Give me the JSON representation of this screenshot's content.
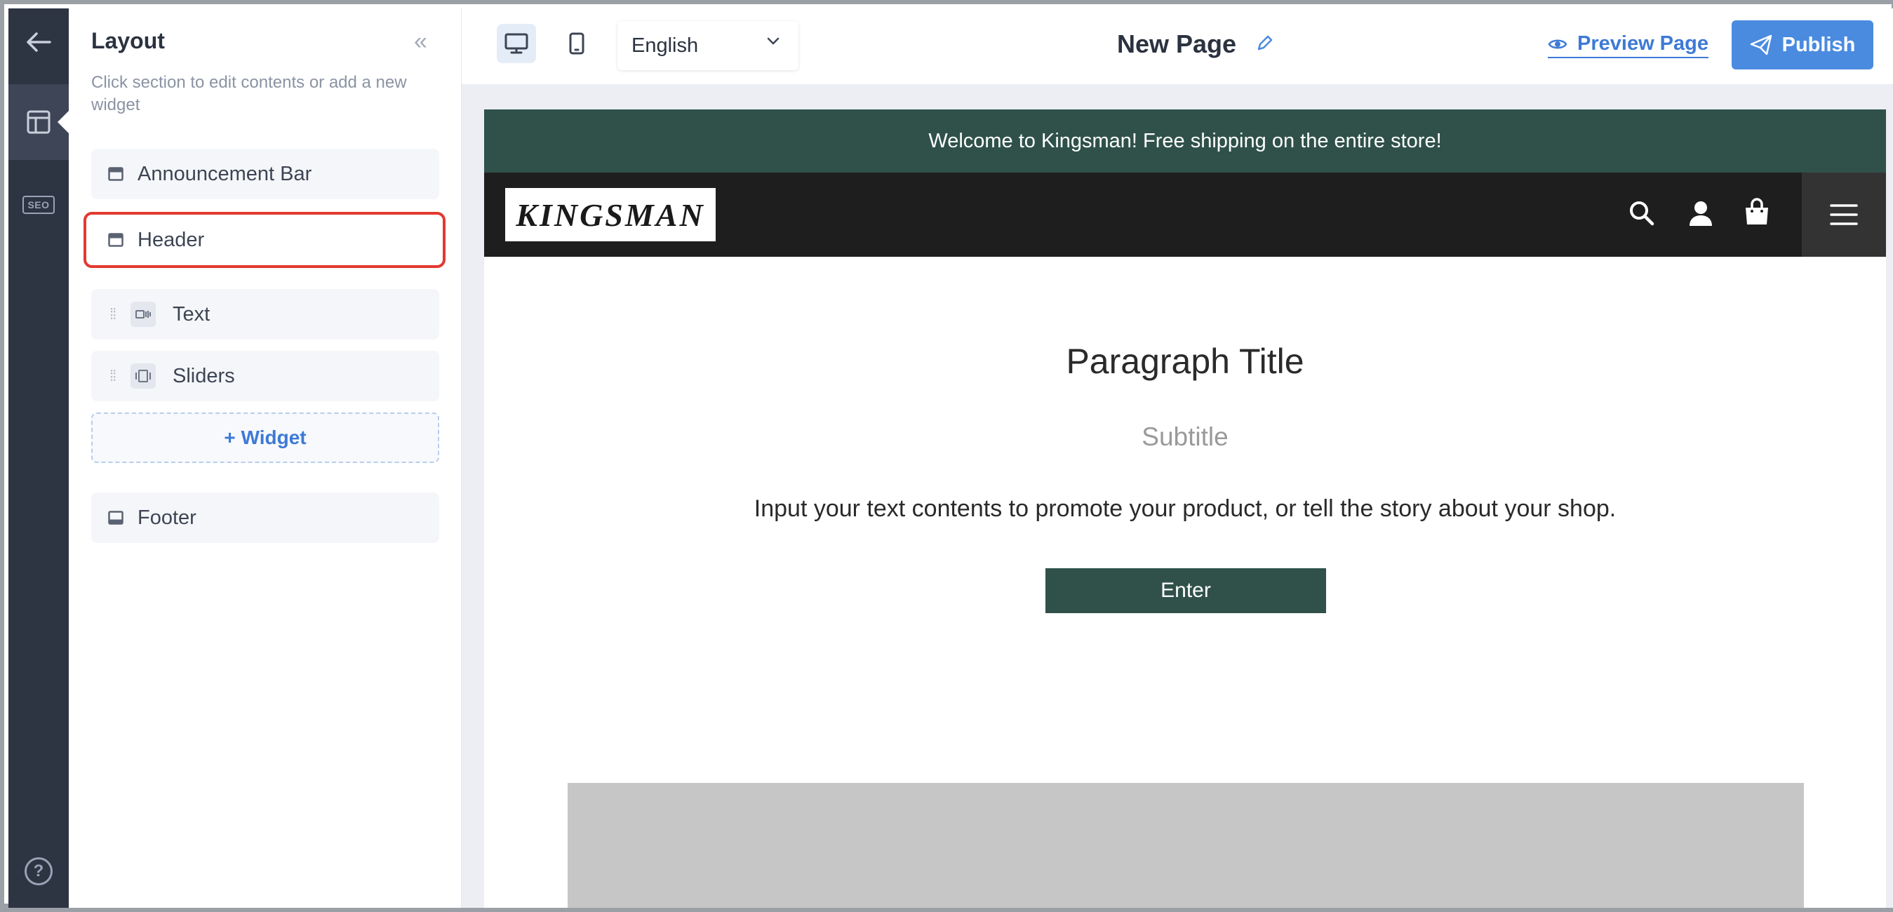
{
  "rail": {
    "back_icon": "arrow-left-icon",
    "layout_icon": "layout-icon",
    "seo_label": "SEO",
    "help_label": "?"
  },
  "panel": {
    "title": "Layout",
    "collapse_glyph": "«",
    "hint": "Click section to edit contents or add a new widget",
    "sections": {
      "announcement_bar": "Announcement Bar",
      "header": "Header",
      "footer": "Footer"
    },
    "widgets": [
      {
        "label": "Text",
        "icon": "text-widget-icon"
      },
      {
        "label": "Sliders",
        "icon": "slider-widget-icon"
      }
    ],
    "add_widget": "+ Widget"
  },
  "toolbar": {
    "language": "English",
    "page_name": "New Page",
    "preview_label": "Preview Page",
    "publish_label": "Publish"
  },
  "site": {
    "announcement": "Welcome to Kingsman! Free shipping on the entire store!",
    "logo_text": "KINGSMAN",
    "paragraph_title": "Paragraph Title",
    "subtitle": "Subtitle",
    "body": "Input your text contents to promote your product, or tell the story about your shop.",
    "button_label": "Enter"
  },
  "colors": {
    "accent": "#4a8be0",
    "rail_bg": "#2d3442",
    "brand_green": "#2f5149",
    "selection_outline": "#e23a2e"
  }
}
